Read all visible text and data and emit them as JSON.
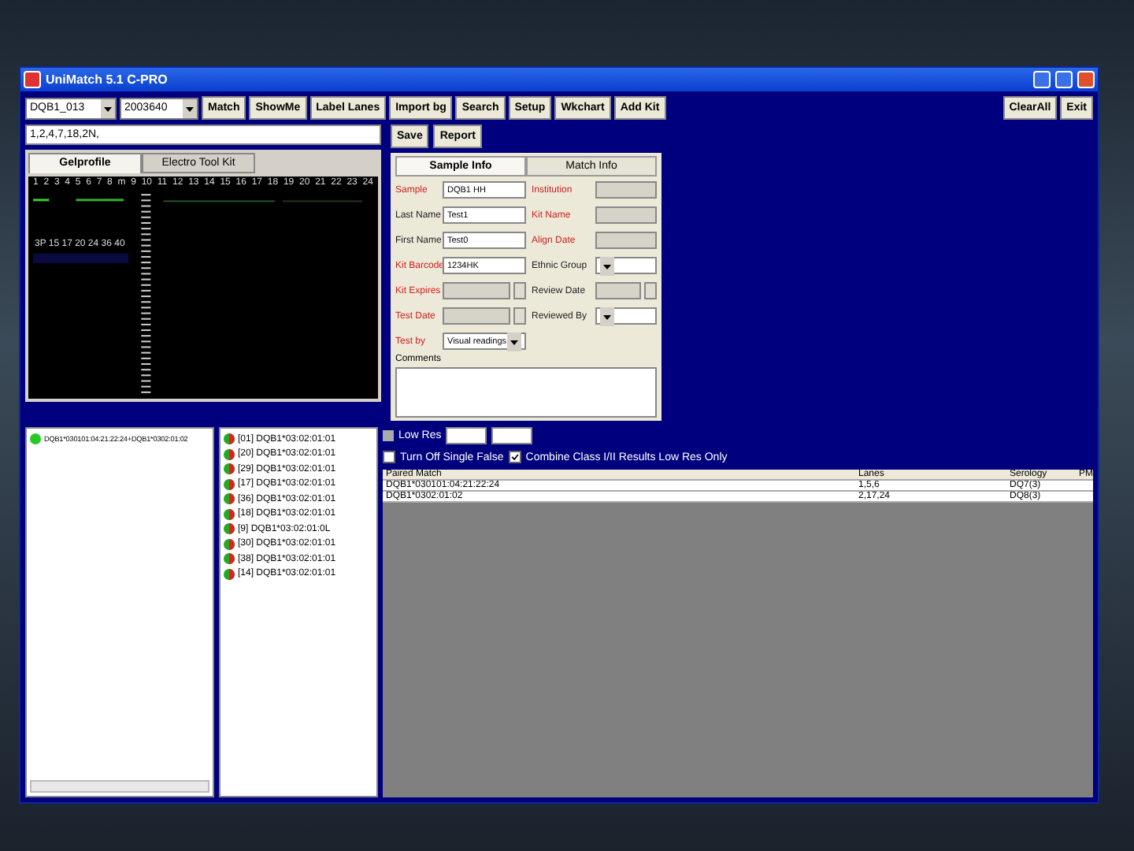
{
  "window": {
    "title": "UniMatch 5.1 C-PRO"
  },
  "toolbar": {
    "locus": "DQB1_013",
    "batch": "2003640",
    "buttons": [
      "Match",
      "ShowMe",
      "Label Lanes",
      "Import bg",
      "Search",
      "Setup",
      "Wkchart",
      "Add Kit"
    ],
    "right_buttons": [
      "ClearAll",
      "Exit"
    ]
  },
  "path_field": {
    "value": "1,2,4,7,18,2N,"
  },
  "gel_tabs": [
    {
      "label": "Gelprofile",
      "selected": true
    },
    {
      "label": "Electro Tool Kit",
      "selected": false
    }
  ],
  "gel": {
    "lanes": [
      "1",
      "2",
      "3",
      "4",
      "5",
      "6",
      "7",
      "8",
      "m",
      "9",
      "10",
      "11",
      "12",
      "13",
      "14",
      "15",
      "16",
      "17",
      "18",
      "19",
      "20",
      "21",
      "22",
      "23",
      "24"
    ],
    "note": "3P 15 17 20 24 36 40"
  },
  "actions": [
    "Save",
    "Report"
  ],
  "info_tabs": [
    {
      "label": "Sample Info",
      "selected": true
    },
    {
      "label": "Match Info",
      "selected": false
    }
  ],
  "left_fields": [
    {
      "label": "Sample",
      "required": true,
      "value": "DQB1 HH",
      "disabled": false,
      "kind": "text"
    },
    {
      "label": "Last Name",
      "required": false,
      "value": "Test1",
      "disabled": false,
      "kind": "text"
    },
    {
      "label": "First Name",
      "required": false,
      "value": "Test0",
      "disabled": false,
      "kind": "text"
    },
    {
      "label": "Kit Barcode",
      "required": true,
      "value": "1234HK",
      "disabled": false,
      "kind": "text"
    },
    {
      "label": "Kit Expires",
      "required": true,
      "disabled": true,
      "kind": "date"
    },
    {
      "label": "Test Date",
      "required": true,
      "disabled": true,
      "kind": "date"
    },
    {
      "label": "Test by",
      "required": true,
      "value": "Visual readings",
      "disabled": false,
      "kind": "select"
    }
  ],
  "right_fields": [
    {
      "label": "Institution",
      "required": true,
      "disabled": true,
      "kind": "text"
    },
    {
      "label": "Kit Name",
      "required": true,
      "disabled": true,
      "kind": "text"
    },
    {
      "label": "Align Date",
      "required": true,
      "disabled": true,
      "kind": "text"
    },
    {
      "label": "Ethnic Group",
      "required": false,
      "disabled": false,
      "kind": "select"
    },
    {
      "label": "Review Date",
      "required": false,
      "disabled": true,
      "kind": "date"
    },
    {
      "label": "Reviewed By",
      "required": false,
      "disabled": false,
      "kind": "select"
    }
  ],
  "comments": {
    "label": "Comments"
  },
  "sample_tree": [
    {
      "label": "DQB1*030101:04:21:22:24+DQB1*0302:01:02",
      "color": "#22cc22"
    }
  ],
  "match_tree": [
    {
      "label": "[01] DQB1*03:02:01:01"
    },
    {
      "label": "[20] DQB1*03:02:01:01"
    },
    {
      "label": "[29] DQB1*03:02:01:01"
    },
    {
      "label": "[17] DQB1*03:02:01:01"
    },
    {
      "label": "[36] DQB1*03:02:01:01"
    },
    {
      "label": "[18] DQB1*03:02:01:01"
    },
    {
      "label": "[9] DQB1*03:02:01:0L"
    },
    {
      "label": "[30] DQB1*03:02:01:01"
    },
    {
      "label": "[38] DQB1*03:02:01:01"
    },
    {
      "label": "[14] DQB1*03:02:01:01"
    }
  ],
  "low_res": {
    "label": "Low Res"
  },
  "options": [
    {
      "label": "Turn Off Single False",
      "checked": false
    },
    {
      "label": "Combine Class I/II Results Low Res Only",
      "checked": true
    }
  ],
  "table": {
    "columns": [
      "Paired Match",
      "Lanes",
      "Serology",
      "PM"
    ],
    "rows": [
      [
        "DQB1*030101:04:21:22:24",
        "1,5,6",
        "DQ7(3)"
      ],
      [
        "DQB1*0302:01:02",
        "2,17,24",
        "DQ8(3)"
      ]
    ]
  }
}
